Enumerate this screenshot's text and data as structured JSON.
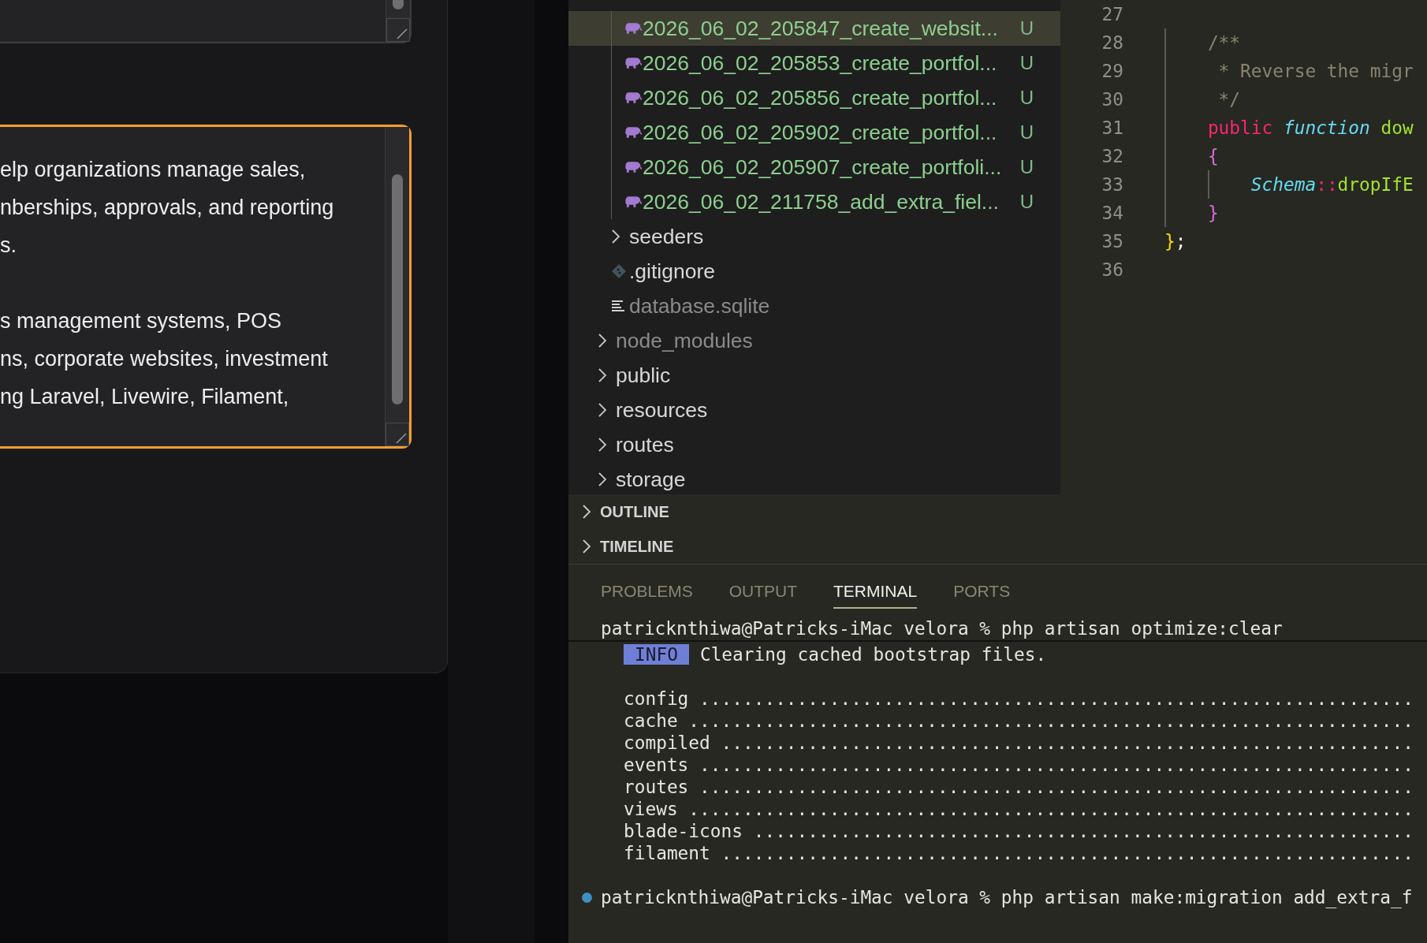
{
  "form": {
    "textareas": [
      {
        "focused": false
      },
      {
        "focused": true,
        "paragraphs": [
          [
            "elp organizations manage sales,",
            "nberships, approvals, and reporting",
            "s."
          ],
          [
            "s management systems, POS",
            "ns, corporate websites, investment",
            "ng Laravel, Livewire, Filament,"
          ]
        ]
      }
    ]
  },
  "explorer": {
    "tree": [
      {
        "children": [
          {
            "children": [
              {
                "label": "2026_06_02_205847_create_websit...",
                "kind": "php",
                "status": "U",
                "selected": true,
                "dimmed": false
              },
              {
                "label": "2026_06_02_205853_create_portfol...",
                "kind": "php",
                "status": "U",
                "selected": false,
                "dimmed": false
              },
              {
                "label": "2026_06_02_205856_create_portfol...",
                "kind": "php",
                "status": "U",
                "selected": false,
                "dimmed": false
              },
              {
                "label": "2026_06_02_205902_create_portfol...",
                "kind": "php",
                "status": "U",
                "selected": false,
                "dimmed": false
              },
              {
                "label": "2026_06_02_205907_create_portfoli...",
                "kind": "php",
                "status": "U",
                "selected": false,
                "dimmed": false
              },
              {
                "label": "2026_06_02_211758_add_extra_fiel...",
                "kind": "php",
                "status": "U",
                "selected": false,
                "dimmed": false
              }
            ]
          },
          {
            "label": "seeders",
            "kind": "folder",
            "selected": false,
            "dimmed": false
          },
          {
            "label": ".gitignore",
            "kind": "git",
            "selected": false,
            "dimmed": false
          },
          {
            "label": "database.sqlite",
            "kind": "file",
            "selected": false,
            "dimmed": true
          }
        ]
      },
      {
        "label": "node_modules",
        "kind": "folder",
        "selected": false,
        "dimmed": true
      },
      {
        "label": "public",
        "kind": "folder",
        "selected": false,
        "dimmed": false
      },
      {
        "label": "resources",
        "kind": "folder",
        "selected": false,
        "dimmed": false
      },
      {
        "label": "routes",
        "kind": "folder",
        "selected": false,
        "dimmed": false
      },
      {
        "label": "storage",
        "kind": "folder",
        "selected": false,
        "dimmed": false
      }
    ]
  },
  "sections": [
    {
      "label": "OUTLINE",
      "expanded": false
    },
    {
      "label": "TIMELINE",
      "expanded": false
    }
  ],
  "editor": {
    "lines": [
      {
        "number": "27"
      },
      {
        "number": "28",
        "tokens": [
          {
            "text": "    /**",
            "kind": "comment"
          }
        ]
      },
      {
        "number": "29",
        "tokens": [
          {
            "text": "     * Reverse the migr",
            "kind": "comment"
          }
        ]
      },
      {
        "number": "30",
        "tokens": [
          {
            "text": "     */",
            "kind": "comment"
          }
        ]
      },
      {
        "number": "31",
        "tokens": [
          {
            "text": "    public",
            "kind": "keyword"
          },
          {
            "text": " function",
            "kind": "storage"
          },
          {
            "text": " dow",
            "kind": "func"
          }
        ]
      },
      {
        "number": "32",
        "tokens": [
          {
            "text": "    {",
            "kind": "brace"
          }
        ]
      },
      {
        "number": "33",
        "tokens": [
          {
            "text": "        Schema",
            "kind": "cls"
          },
          {
            "text": "::",
            "kind": "op"
          },
          {
            "text": "dropIfE",
            "kind": "func"
          }
        ]
      },
      {
        "number": "34",
        "tokens": [
          {
            "text": "    }",
            "kind": "brace"
          }
        ]
      },
      {
        "number": "35",
        "tokens": [
          {
            "text": "}",
            "kind": "bracket"
          },
          {
            "text": ";",
            "kind": "plain"
          }
        ]
      },
      {
        "number": "36"
      }
    ]
  },
  "panel": {
    "tabs": [
      {
        "label": "PROBLEMS",
        "selected": false
      },
      {
        "label": "OUTPUT",
        "selected": false
      },
      {
        "label": "TERMINAL",
        "selected": true
      },
      {
        "label": "PORTS",
        "selected": false
      }
    ],
    "terminal": [
      {
        "kind": "prompt",
        "text": "patricknthiwa@Patricks-iMac velora % php artisan optimize:clear",
        "dot": false,
        "sticky": true
      },
      {
        "kind": "info",
        "badge": "INFO",
        "text": "Clearing cached bootstrap files."
      },
      {
        "kind": "blank"
      },
      {
        "kind": "task",
        "text": "config .................................................................."
      },
      {
        "kind": "task",
        "text": "cache ..................................................................."
      },
      {
        "kind": "task",
        "text": "compiled ................................................................"
      },
      {
        "kind": "task",
        "text": "events .................................................................."
      },
      {
        "kind": "task",
        "text": "routes .................................................................."
      },
      {
        "kind": "task",
        "text": "views ..................................................................."
      },
      {
        "kind": "task",
        "text": "blade-icons ............................................................."
      },
      {
        "kind": "task",
        "text": "filament ................................................................"
      },
      {
        "kind": "blank"
      },
      {
        "kind": "prompt",
        "text": "patricknthiwa@Patricks-iMac velora % php artisan make:migration add_extra_f",
        "dot": true,
        "sticky": false
      }
    ]
  }
}
